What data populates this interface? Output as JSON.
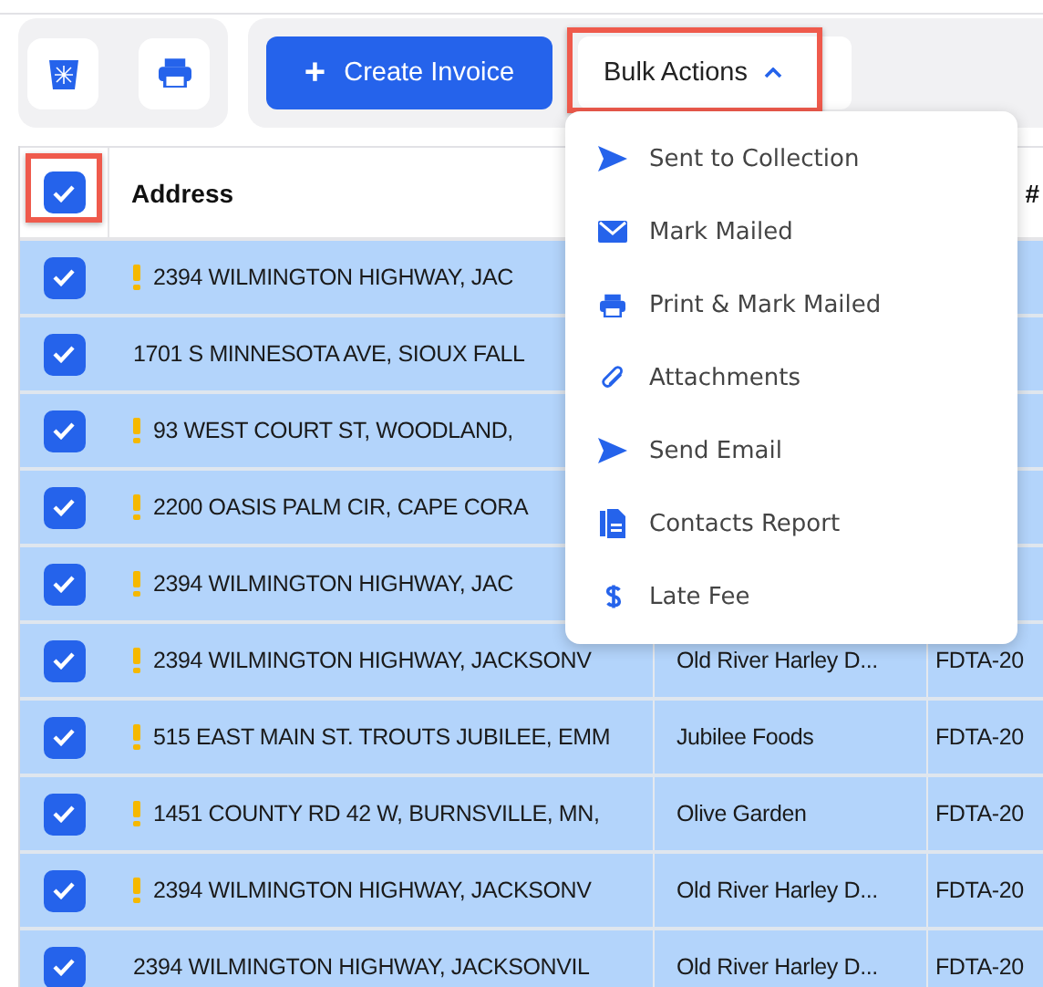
{
  "toolbar": {
    "icon_buttons": [
      {
        "kind": "trash"
      },
      {
        "kind": "print"
      }
    ],
    "create_button": {
      "label": "Create Invoice",
      "icon": "+"
    },
    "bulk_button": {
      "label": "Bulk Actions",
      "expanded": true,
      "highlighted": true
    }
  },
  "bulk_menu": [
    {
      "label": "Sent to Collection",
      "kind": "send"
    },
    {
      "label": "Mark Mailed",
      "kind": "mail"
    },
    {
      "label": "Print & Mark Mailed",
      "kind": "print"
    },
    {
      "label": "Attachments",
      "kind": "clip"
    },
    {
      "label": "Send Email",
      "kind": "send"
    },
    {
      "label": "Contacts Report",
      "kind": "report"
    },
    {
      "label": "Late Fee",
      "kind": "dollar"
    }
  ],
  "table": {
    "select_all": {
      "checked": true,
      "highlighted": true
    },
    "columns": [
      {
        "label": "Address"
      },
      {
        "label": "#"
      }
    ],
    "rows": [
      {
        "checked": true,
        "warning": true,
        "address": "2394 WILMINGTON HIGHWAY, JAC"
      },
      {
        "checked": true,
        "warning": false,
        "address": "1701 S MINNESOTA AVE, SIOUX FALL"
      },
      {
        "checked": true,
        "warning": true,
        "address": "93 WEST COURT ST, WOODLAND,"
      },
      {
        "checked": true,
        "warning": true,
        "address": "2200 OASIS PALM CIR, CAPE CORA"
      },
      {
        "checked": true,
        "warning": true,
        "address": "2394 WILMINGTON HIGHWAY, JAC"
      },
      {
        "checked": true,
        "warning": true,
        "address": "2394 WILMINGTON HIGHWAY, JACKSONV",
        "column_3": "Old River Harley D...",
        "column_4": "FDTA-20"
      },
      {
        "checked": true,
        "warning": true,
        "address": "515 EAST MAIN ST. TROUTS JUBILEE, EMM",
        "column_3": "Jubilee Foods",
        "column_4": "FDTA-20"
      },
      {
        "checked": true,
        "warning": true,
        "address": "1451 COUNTY RD 42 W, BURNSVILLE, MN,",
        "column_3": "Olive Garden",
        "column_4": "FDTA-20"
      },
      {
        "checked": true,
        "warning": true,
        "address": "2394 WILMINGTON HIGHWAY, JACKSONV",
        "column_3": "Old River Harley D...",
        "column_4": "FDTA-20"
      },
      {
        "checked": true,
        "warning": false,
        "address": "2394 WILMINGTON HIGHWAY, JACKSONVIL",
        "column_3": "Old River Harley D...",
        "column_4": "FDTA-20"
      }
    ]
  }
}
